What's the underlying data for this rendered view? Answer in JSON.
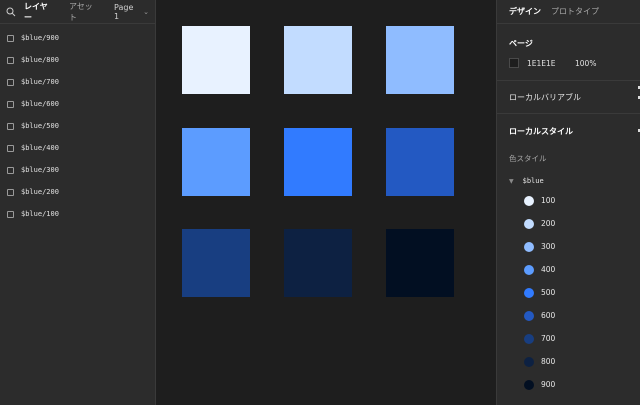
{
  "left_panel": {
    "tabs": [
      "レイヤー",
      "アセット"
    ],
    "page_selector": "Page 1",
    "layers": [
      "$blue/900",
      "$blue/800",
      "$blue/700",
      "$blue/600",
      "$blue/500",
      "$blue/400",
      "$blue/300",
      "$blue/200",
      "$blue/100"
    ]
  },
  "canvas": {
    "swatch_colors": [
      "#e8f2ff",
      "#c2dcff",
      "#8fbcff",
      "#5c9cff",
      "#317bff",
      "#2359c2",
      "#183e81",
      "#0d2142",
      "#020f22"
    ]
  },
  "right_panel": {
    "tabs": [
      "デザイン",
      "プロトタイプ"
    ],
    "page_section": {
      "title": "ページ",
      "bg_hex": "1E1E1E",
      "opacity": "100%"
    },
    "local_variables": "ローカルバリアブル",
    "local_styles": {
      "title": "ローカルスタイル",
      "color_styles_label": "色スタイル",
      "group_name": "$blue",
      "colors": [
        {
          "label": "100",
          "color": "#e8f2ff"
        },
        {
          "label": "200",
          "color": "#c2dcff"
        },
        {
          "label": "300",
          "color": "#8fbcff"
        },
        {
          "label": "400",
          "color": "#5c9cff"
        },
        {
          "label": "500",
          "color": "#317bff"
        },
        {
          "label": "600",
          "color": "#2359c2"
        },
        {
          "label": "700",
          "color": "#183e81"
        },
        {
          "label": "800",
          "color": "#0d2142"
        },
        {
          "label": "900",
          "color": "#020f22"
        }
      ]
    }
  }
}
